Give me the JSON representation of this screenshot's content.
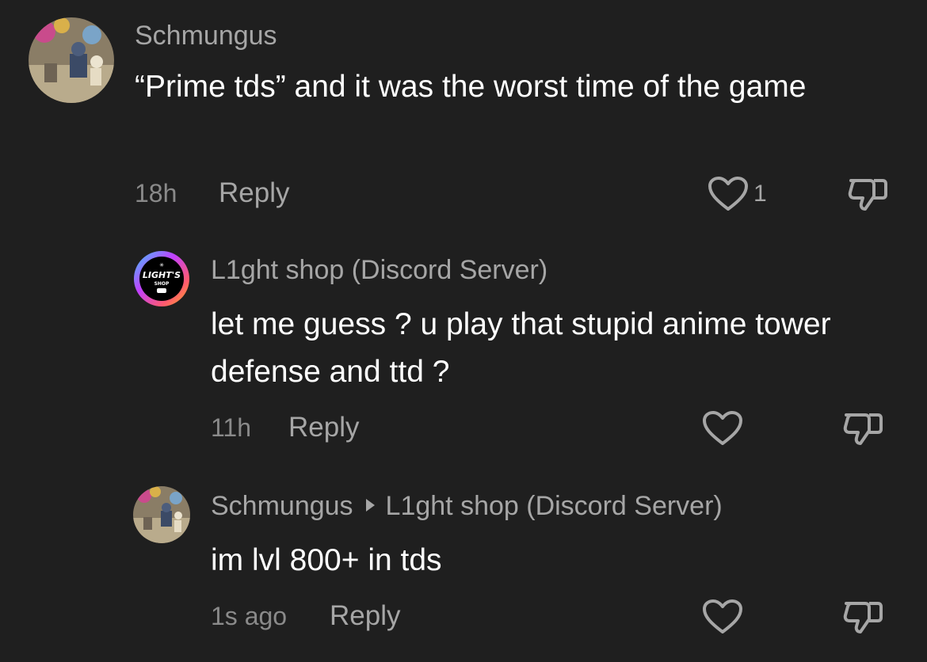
{
  "comments": [
    {
      "username": "Schmungus",
      "text": "“Prime tds” and it was the worst time of the game",
      "time": "18h",
      "reply_label": "Reply",
      "like_count": "1",
      "like_icon": "heart-outline-icon",
      "dislike_icon": "thumbs-down-icon",
      "avatar": "game-screenshot-avatar"
    },
    {
      "username": "L1ght shop (Discord Server)",
      "text": "let me guess ? u play that stupid anime tower defense and ttd ?",
      "time": "11h",
      "reply_label": "Reply",
      "like_icon": "heart-outline-icon",
      "dislike_icon": "thumbs-down-icon",
      "avatar": "lights-shop-logo",
      "avatar_logo_text": "LIGHT'S",
      "avatar_logo_sub": "SHOP"
    },
    {
      "username": "Schmungus",
      "reply_to": "L1ght shop (Discord Server)",
      "text": "im lvl 800+ in tds",
      "time": "1s ago",
      "reply_label": "Reply",
      "like_icon": "heart-outline-icon",
      "dislike_icon": "thumbs-down-icon",
      "avatar": "game-screenshot-avatar"
    }
  ],
  "colors": {
    "background": "#1f1f1f",
    "primary_text": "#ffffff",
    "secondary_text": "#a6a6a6",
    "timestamp": "#8a8a8a"
  }
}
